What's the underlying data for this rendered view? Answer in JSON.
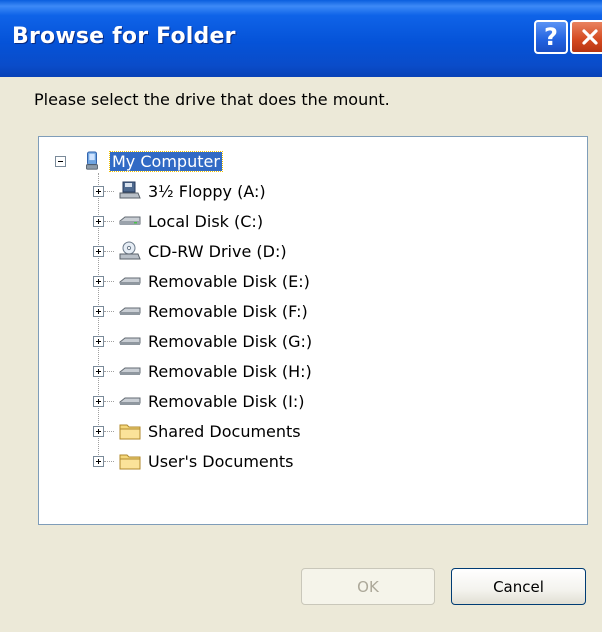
{
  "window": {
    "title": "Browse for Folder"
  },
  "title_buttons": {
    "help": "?",
    "close_icon": "close-icon"
  },
  "prompt": "Please select the drive that does the mount.",
  "tree": {
    "root": {
      "label": "My Computer",
      "icon": "my-computer-icon",
      "expanded": true,
      "selected": true
    },
    "children": [
      {
        "label": "3½ Floppy (A:)",
        "icon": "floppy-drive-icon"
      },
      {
        "label": "Local Disk (C:)",
        "icon": "hard-disk-icon"
      },
      {
        "label": "CD-RW Drive (D:)",
        "icon": "cd-drive-icon"
      },
      {
        "label": "Removable Disk (E:)",
        "icon": "removable-disk-icon"
      },
      {
        "label": "Removable Disk (F:)",
        "icon": "removable-disk-icon"
      },
      {
        "label": "Removable Disk (G:)",
        "icon": "removable-disk-icon"
      },
      {
        "label": "Removable Disk (H:)",
        "icon": "removable-disk-icon"
      },
      {
        "label": "Removable Disk (I:)",
        "icon": "removable-disk-icon"
      },
      {
        "label": "Shared Documents",
        "icon": "folder-icon"
      },
      {
        "label": "User's Documents",
        "icon": "folder-icon"
      }
    ]
  },
  "buttons": {
    "ok": "OK",
    "cancel": "Cancel"
  },
  "colors": {
    "titlebar": "#0553d8",
    "selection": "#316ac5",
    "dialog_bg": "#ece9d8"
  }
}
